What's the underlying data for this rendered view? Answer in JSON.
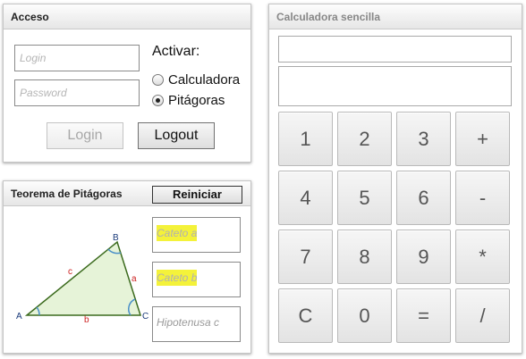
{
  "acceso": {
    "title": "Acceso",
    "login_placeholder": "Login",
    "password_placeholder": "Password",
    "activar_label": "Activar:",
    "options": [
      {
        "label": "Calculadora",
        "checked": false
      },
      {
        "label": "Pitágoras",
        "checked": true
      }
    ],
    "login_button": "Login",
    "logout_button": "Logout"
  },
  "pitagoras": {
    "title": "Teorema de Pitágoras",
    "reset_button": "Reiniciar",
    "diagram": {
      "vertex_a": "A",
      "vertex_b": "B",
      "vertex_c": "C",
      "side_a": "a",
      "side_b": "b",
      "side_c": "c",
      "fill_color": "#e6f3d8",
      "stroke_color": "#3c6b1e",
      "angle_color": "#4a90c8",
      "side_label_color": "#cc2222"
    },
    "fields": {
      "cateto_a": "Cateto a",
      "cateto_b": "Cateto b",
      "hipotenusa": "Hipotenusa c"
    },
    "highlight_color": "#f4f23a"
  },
  "calculadora": {
    "title": "Calculadora sencilla",
    "display_top": "",
    "display_main": "",
    "keys": [
      [
        "1",
        "2",
        "3",
        "+"
      ],
      [
        "4",
        "5",
        "6",
        "-"
      ],
      [
        "7",
        "8",
        "9",
        "*"
      ],
      [
        "C",
        "0",
        "=",
        "/"
      ]
    ]
  }
}
